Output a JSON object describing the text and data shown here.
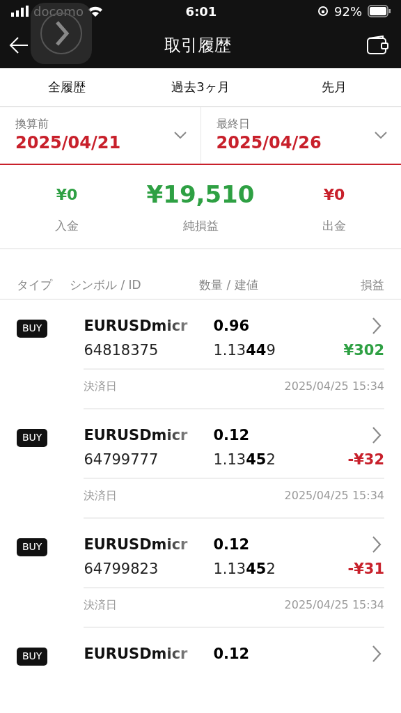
{
  "status_bar": {
    "carrier": "docomo",
    "time": "6:01",
    "battery": "92%"
  },
  "nav": {
    "title": "取引履歴"
  },
  "tabs": [
    "全履歴",
    "過去3ヶ月",
    "先月"
  ],
  "date_range": [
    {
      "label": "換算前",
      "value": "2025/04/21"
    },
    {
      "label": "最終日",
      "value": "2025/04/26"
    }
  ],
  "summary": [
    {
      "amount": "¥0",
      "label": "入金",
      "color": "#2ea043",
      "kind": "side"
    },
    {
      "amount": "¥19,510",
      "label": "純損益",
      "color": "#2ea043",
      "kind": "main"
    },
    {
      "amount": "¥0",
      "label": "出金",
      "color": "#c8202b",
      "kind": "side"
    }
  ],
  "table": {
    "columns": [
      "タイプ",
      "シンボル / ID",
      "数量 / 建値",
      "損益"
    ],
    "rows": [
      {
        "type": "BUY",
        "symbol": "EURUSDmicr",
        "volume": "0.96",
        "id": "64818375",
        "price": "1.13**44**9",
        "pnl": "¥302",
        "color": "#2ea043",
        "date_label": "決済日",
        "date": "2025/04/25 15:34"
      },
      {
        "type": "BUY",
        "symbol": "EURUSDmicr",
        "volume": "0.12",
        "id": "64799777",
        "price": "1.13**45**2",
        "pnl": "-¥32",
        "color": "#c8202b",
        "date_label": "決済日",
        "date": "2025/04/25 15:34"
      },
      {
        "type": "BUY",
        "symbol": "EURUSDmicr",
        "volume": "0.12",
        "id": "64799823",
        "price": "1.13**45**2",
        "pnl": "-¥31",
        "color": "#c8202b",
        "date_label": "決済日",
        "date": "2025/04/25 15:34"
      },
      {
        "type": "BUY",
        "symbol": "EURUSDmicr",
        "volume": "0.12"
      }
    ]
  }
}
